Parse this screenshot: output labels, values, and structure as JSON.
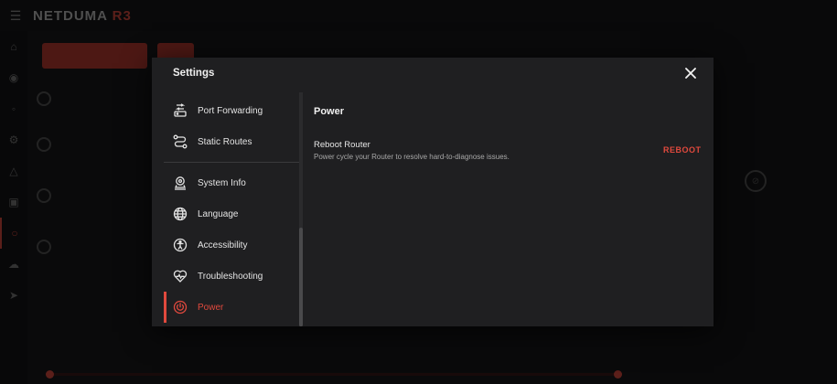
{
  "dialog": {
    "title": "Settings",
    "close_icon": "close-icon"
  },
  "menu": {
    "items": [
      {
        "label": "Port Forwarding",
        "icon": "port-forwarding-icon"
      },
      {
        "label": "Static Routes",
        "icon": "static-routes-icon"
      },
      {
        "label": "System Info",
        "icon": "system-info-icon"
      },
      {
        "label": "Language",
        "icon": "globe-icon"
      },
      {
        "label": "Accessibility",
        "icon": "accessibility-icon"
      },
      {
        "label": "Troubleshooting",
        "icon": "heart-pulse-icon"
      },
      {
        "label": "Power",
        "icon": "power-icon"
      }
    ],
    "active": "Power"
  },
  "content": {
    "section_title": "Power",
    "option_title": "Reboot Router",
    "option_description": "Power cycle your Router to resolve hard-to-diagnose issues.",
    "action_label": "REBOOT"
  },
  "colors": {
    "accent": "#e0493d",
    "dialog_bg": "#1f1f21"
  }
}
